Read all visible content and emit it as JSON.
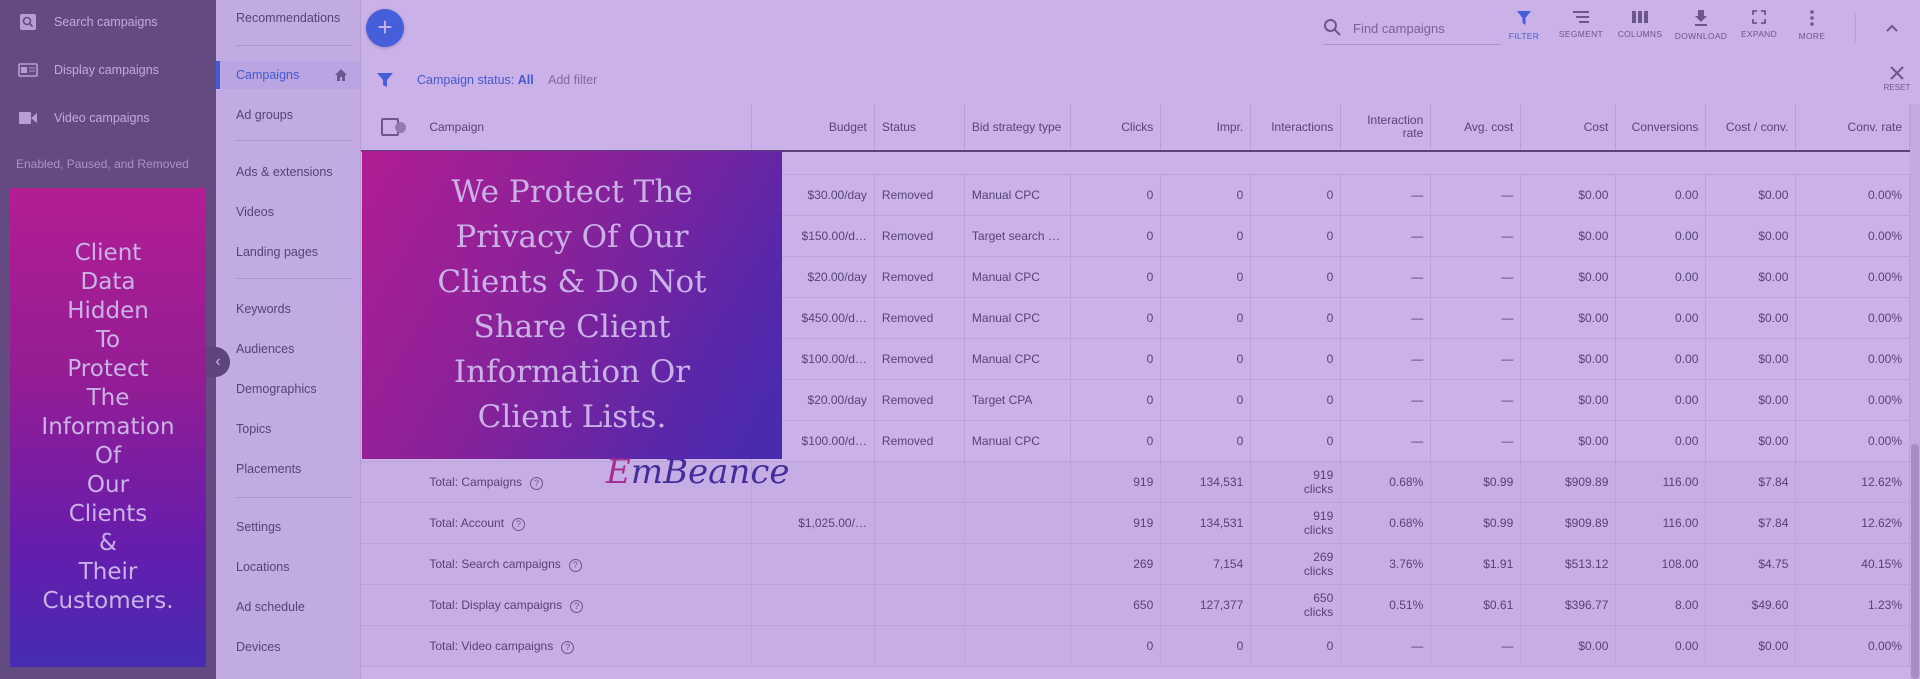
{
  "left_nav": {
    "items": [
      {
        "label": "Search campaigns",
        "icon": "search-campaigns-icon"
      },
      {
        "label": "Display campaigns",
        "icon": "display-campaigns-icon"
      },
      {
        "label": "Video campaigns",
        "icon": "video-campaigns-icon"
      }
    ],
    "filter_label": "Enabled, Paused, and Removed",
    "privacy_text": "Client\nData\nHidden\nTo\nProtect\nThe\nInformation\nOf\nOur\nClients\n&\nTheir\nCustomers."
  },
  "sub_nav": {
    "items": [
      "Recommendations",
      "Campaigns",
      "Ad groups",
      "Ads & extensions",
      "Videos",
      "Landing pages",
      "Keywords",
      "Audiences",
      "Demographics",
      "Topics",
      "Placements",
      "Settings",
      "Locations",
      "Ad schedule",
      "Devices"
    ],
    "active": "Campaigns"
  },
  "toolbar": {
    "search_placeholder": "Find campaigns",
    "buttons": [
      "FILTER",
      "SEGMENT",
      "COLUMNS",
      "DOWNLOAD",
      "EXPAND",
      "MORE"
    ]
  },
  "filter_bar": {
    "status_label": "Campaign status:",
    "status_value": "All",
    "add_filter": "Add filter",
    "reset": "RESET"
  },
  "table": {
    "headers": [
      "Campaign",
      "Budget",
      "Status",
      "Bid strategy type",
      "Clicks",
      "Impr.",
      "Interactions",
      "Interaction rate",
      "Avg. cost",
      "Cost",
      "Conversions",
      "Cost / conv.",
      "Conv. rate"
    ],
    "rows": [
      {
        "budget": "$30.00/day",
        "status": "Removed",
        "strategy": "Manual CPC",
        "clicks": "0",
        "impr": "0",
        "interactions": "0",
        "irate": "—",
        "avg": "—",
        "cost": "$0.00",
        "conv": "0.00",
        "cpc": "$0.00",
        "crate": "0.00%"
      },
      {
        "budget": "$150.00/d…",
        "status": "Removed",
        "strategy": "Target search …",
        "clicks": "0",
        "impr": "0",
        "interactions": "0",
        "irate": "—",
        "avg": "—",
        "cost": "$0.00",
        "conv": "0.00",
        "cpc": "$0.00",
        "crate": "0.00%"
      },
      {
        "budget": "$20.00/day",
        "status": "Removed",
        "strategy": "Manual CPC",
        "clicks": "0",
        "impr": "0",
        "interactions": "0",
        "irate": "—",
        "avg": "—",
        "cost": "$0.00",
        "conv": "0.00",
        "cpc": "$0.00",
        "crate": "0.00%"
      },
      {
        "budget": "$450.00/d…",
        "status": "Removed",
        "strategy": "Manual CPC",
        "clicks": "0",
        "impr": "0",
        "interactions": "0",
        "irate": "—",
        "avg": "—",
        "cost": "$0.00",
        "conv": "0.00",
        "cpc": "$0.00",
        "crate": "0.00%"
      },
      {
        "budget": "$100.00/d…",
        "status": "Removed",
        "strategy": "Manual CPC",
        "clicks": "0",
        "impr": "0",
        "interactions": "0",
        "irate": "—",
        "avg": "—",
        "cost": "$0.00",
        "conv": "0.00",
        "cpc": "$0.00",
        "crate": "0.00%"
      },
      {
        "budget": "$20.00/day",
        "status": "Removed",
        "strategy": "Target CPA",
        "clicks": "0",
        "impr": "0",
        "interactions": "0",
        "irate": "—",
        "avg": "—",
        "cost": "$0.00",
        "conv": "0.00",
        "cpc": "$0.00",
        "crate": "0.00%"
      },
      {
        "budget": "$100.00/d…",
        "status": "Removed",
        "strategy": "Manual CPC",
        "clicks": "0",
        "impr": "0",
        "interactions": "0",
        "irate": "—",
        "avg": "—",
        "cost": "$0.00",
        "conv": "0.00",
        "cpc": "$0.00",
        "crate": "0.00%"
      }
    ],
    "totals": [
      {
        "label": "Total: Campaigns",
        "budget": "",
        "clicks": "919",
        "impr": "134,531",
        "interactions": "919",
        "int_unit": "clicks",
        "irate": "0.68%",
        "avg": "$0.99",
        "cost": "$909.89",
        "conv": "116.00",
        "cpc": "$7.84",
        "crate": "12.62%"
      },
      {
        "label": "Total: Account",
        "budget": "$1,025.00/…",
        "clicks": "919",
        "impr": "134,531",
        "interactions": "919",
        "int_unit": "clicks",
        "irate": "0.68%",
        "avg": "$0.99",
        "cost": "$909.89",
        "conv": "116.00",
        "cpc": "$7.84",
        "crate": "12.62%"
      },
      {
        "label": "Total: Search campaigns",
        "budget": "",
        "clicks": "269",
        "impr": "7,154",
        "interactions": "269",
        "int_unit": "clicks",
        "irate": "3.76%",
        "avg": "$1.91",
        "cost": "$513.12",
        "conv": "108.00",
        "cpc": "$4.75",
        "crate": "40.15%"
      },
      {
        "label": "Total: Display campaigns",
        "budget": "",
        "clicks": "650",
        "impr": "127,377",
        "interactions": "650",
        "int_unit": "clicks",
        "irate": "0.51%",
        "avg": "$0.61",
        "cost": "$396.77",
        "conv": "8.00",
        "cpc": "$49.60",
        "crate": "1.23%"
      },
      {
        "label": "Total: Video campaigns",
        "budget": "",
        "clicks": "0",
        "impr": "0",
        "interactions": "0",
        "int_unit": "",
        "irate": "—",
        "avg": "—",
        "cost": "$0.00",
        "conv": "0.00",
        "cpc": "$0.00",
        "crate": "0.00%"
      }
    ]
  },
  "overlay": {
    "banner_text": "We Protect The\nPrivacy Of  Our\nClients & Do Not\nShare Client\nInformation Or\nClient Lists.",
    "logo": "EmBeance"
  },
  "colors": {
    "accent": "#1a73e8",
    "removed": "#c5221f",
    "tint": "#8046c8"
  }
}
